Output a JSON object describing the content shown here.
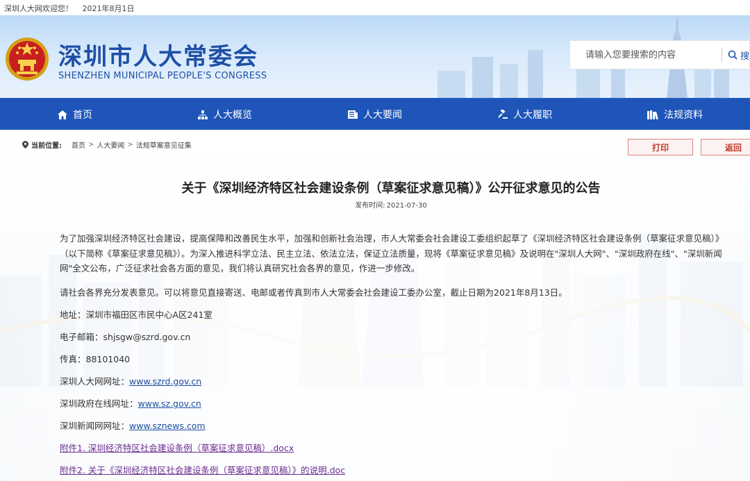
{
  "topbar": {
    "welcome": "深圳人大网欢迎您！",
    "date": "2021年8月1日"
  },
  "header": {
    "title": "深圳市人大常委会",
    "subtitle": "SHENZHEN MUNICIPAL PEOPLE'S CONGRESS",
    "emblem_icon": "national-emblem-icon"
  },
  "search": {
    "placeholder": "请输入您要搜索的内容",
    "button_label": "搜"
  },
  "nav": {
    "items": [
      {
        "label": "首页",
        "icon": "home-icon"
      },
      {
        "label": "人大概览",
        "icon": "org-chart-icon"
      },
      {
        "label": "人大要闻",
        "icon": "news-icon"
      },
      {
        "label": "人大履职",
        "icon": "gavel-icon"
      },
      {
        "label": "法规资料",
        "icon": "books-icon"
      }
    ]
  },
  "breadcrumb": {
    "label": "当前位置:",
    "items": [
      "首页",
      "人大要闻",
      "法规草案意见征集"
    ],
    "separator": ">"
  },
  "actions": {
    "print_label": "打印",
    "back_label": "返回"
  },
  "article": {
    "title": "关于《深圳经济特区社会建设条例（草案征求意见稿）》公开征求意见的公告",
    "publish_label": "发布时间:",
    "publish_date": "2021-07-30",
    "paragraph1": "为了加强深圳经济特区社会建设，提高保障和改善民生水平，加强和创新社会治理，市人大常委会社会建设工委组织起草了《深圳经济特区社会建设条例（草案征求意见稿）》（以下简称《草案征求意见稿》）。为深入推进科学立法、民主立法、依法立法，保证立法质量，现将《草案征求意见稿》及说明在\"深圳人大网\"、\"深圳政府在线\"、\"深圳新闻网\"全文公布，广泛征求社会各方面的意见，我们将认真研究社会各界的意见，作进一步修改。",
    "paragraph2": "请社会各界充分发表意见。可以将意见直接寄送、电邮或者传真到市人大常委会社会建设工委办公室，截止日期为2021年8月13日。",
    "address": "地址：深圳市福田区市民中心A区241室",
    "email_label": "电子邮箱：",
    "email": "shjsgw@szrd.gov.cn",
    "fax": "传真：88101040",
    "szrd_label": "深圳人大网网址：",
    "szrd_url": "www.szrd.gov.cn",
    "sz_label": "深圳政府在线网址：",
    "sz_url": "www.sz.gov.cn",
    "sznews_label": "深圳新闻网网址：",
    "sznews_url": "www.sznews.com",
    "attachment1": "附件1. 深圳经济特区社会建设条例（草案征求意见稿）.docx",
    "attachment2": "附件2. 关于《深圳经济特区社会建设条例（草案征求意见稿）》的说明.doc"
  },
  "colors": {
    "brand_blue": "#1f55b8",
    "title_blue": "#1f4fa6",
    "action_red": "#c0392b",
    "link_purple": "#6a2c8f"
  }
}
